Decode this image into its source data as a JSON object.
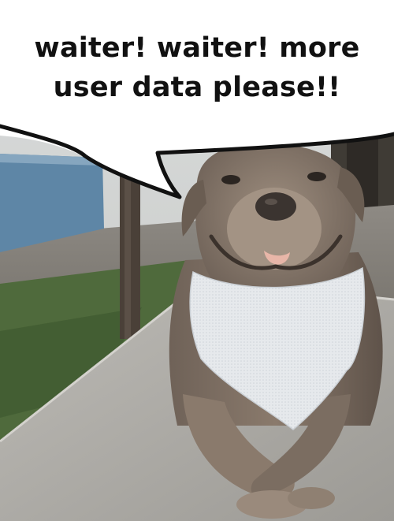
{
  "caption": {
    "line1": "waiter! waiter! more",
    "line2": "user data please!!"
  },
  "image": {
    "subject_icon": "smiling-dog-photo",
    "bubble_icon": "speech-bubble"
  },
  "colors": {
    "bubble_fill": "#ffffff",
    "bubble_outline": "#111111",
    "text": "#111111",
    "wall": "#5e86a6",
    "grass": "#4f6a3c",
    "concrete": "#a9a7a2",
    "dog_coat": "#8a7a6c",
    "bandana": "#e6e9ec"
  }
}
